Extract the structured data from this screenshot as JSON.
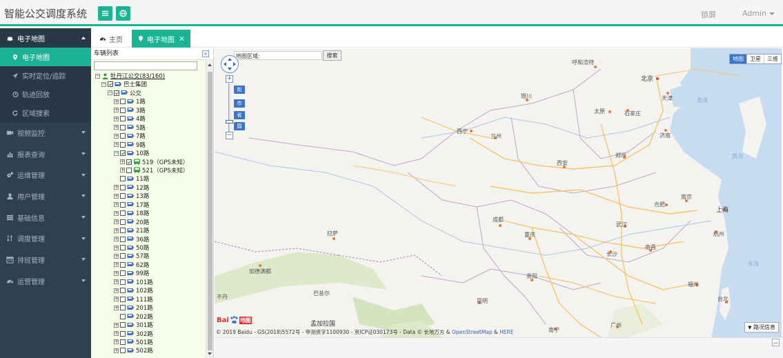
{
  "header": {
    "app_title": "智能公交调度系统",
    "lock_label": "锁屏",
    "user_label": "Admin"
  },
  "sidebar": {
    "items": [
      {
        "label": "电子地图",
        "icon": "car-icon",
        "open": true,
        "children": [
          {
            "label": "电子地图",
            "icon": "map-marker-icon",
            "active": true
          },
          {
            "label": "实时定位/追踪",
            "icon": "location-arrow-icon"
          },
          {
            "label": "轨迹回放",
            "icon": "history-icon"
          },
          {
            "label": "区域搜索",
            "icon": "refresh-icon"
          }
        ]
      },
      {
        "label": "视频监控",
        "icon": "video-camera-icon"
      },
      {
        "label": "报表查询",
        "icon": "bar-chart-icon"
      },
      {
        "label": "运维管理",
        "icon": "gears-icon"
      },
      {
        "label": "用户管理",
        "icon": "user-icon"
      },
      {
        "label": "基础信息",
        "icon": "list-icon"
      },
      {
        "label": "调度管理",
        "icon": "sort-icon"
      },
      {
        "label": "排班管理",
        "icon": "calendar-icon"
      },
      {
        "label": "运营管理",
        "icon": "dashboard-icon"
      }
    ]
  },
  "tabs": {
    "home_label": "主页",
    "active_label": "电子地图",
    "close_symbol": "✕"
  },
  "vehicle_panel": {
    "title": "车辆列表",
    "collapse_symbol": "«",
    "tree": {
      "root": "牡丹江公交(83/160)",
      "group": "巴士集团",
      "category": "公交",
      "routes": [
        "1路",
        "3路",
        "4路",
        "5路",
        "7路",
        "9路",
        "10路",
        "11路",
        "12路",
        "13路",
        "17路",
        "18路",
        "20路",
        "21路",
        "36路",
        "50路",
        "57路",
        "62路",
        "99路",
        "101路",
        "102路",
        "111路",
        "201路",
        "202路",
        "301路",
        "302路",
        "501路",
        "502路"
      ],
      "expanded_route": "10路",
      "vehicles": [
        "519（GPS未知）",
        "521（GPS未知）"
      ]
    }
  },
  "map": {
    "search_label": "地图区域:",
    "search_button": "搜索",
    "map_types": [
      "地图",
      "卫星",
      "三维"
    ],
    "level_tags": [
      "街",
      "市",
      "省",
      "国"
    ],
    "zoom_in": "+",
    "zoom_out": "−",
    "traffic_button": "路况信息",
    "baidu_text_1": "Bai",
    "baidu_text_2": "地图",
    "copyright_text": "© 2019 Baidu - GS(2018)5572号 - 甲测资字1100930 - 京ICP证030173号 - Data © 长地万方 & ",
    "copyright_osm": "OpenStreetMap",
    "copyright_amp": " & ",
    "copyright_here": "HERE",
    "cities": [
      {
        "name": "呼和浩特"
      },
      {
        "name": "北京"
      },
      {
        "name": "天津"
      },
      {
        "name": "银川"
      },
      {
        "name": "太原"
      },
      {
        "name": "石家庄"
      },
      {
        "name": "西宁"
      },
      {
        "name": "兰州"
      },
      {
        "name": "济南"
      },
      {
        "name": "郑州"
      },
      {
        "name": "西安"
      },
      {
        "name": "合肥"
      },
      {
        "name": "南京"
      },
      {
        "name": "上海"
      },
      {
        "name": "成都"
      },
      {
        "name": "武汉"
      },
      {
        "name": "杭州"
      },
      {
        "name": "重庆"
      },
      {
        "name": "长沙"
      },
      {
        "name": "南昌"
      },
      {
        "name": "拉萨"
      },
      {
        "name": "贵阳"
      },
      {
        "name": "福州"
      },
      {
        "name": "昆明"
      },
      {
        "name": "台北"
      },
      {
        "name": "广州"
      },
      {
        "name": "南宁"
      }
    ],
    "regions": [
      {
        "name": "加德满都"
      },
      {
        "name": "巴昔尔"
      },
      {
        "name": "孟加拉国"
      },
      {
        "name": "不丹"
      },
      {
        "name": "渤海"
      },
      {
        "name": "黄海"
      },
      {
        "name": "东海"
      }
    ]
  },
  "colors": {
    "accent": "#1ab394",
    "sidebar_bg": "#2f4050",
    "sidebar_sub_bg": "#293846",
    "map_blue": "#3b75c7"
  }
}
